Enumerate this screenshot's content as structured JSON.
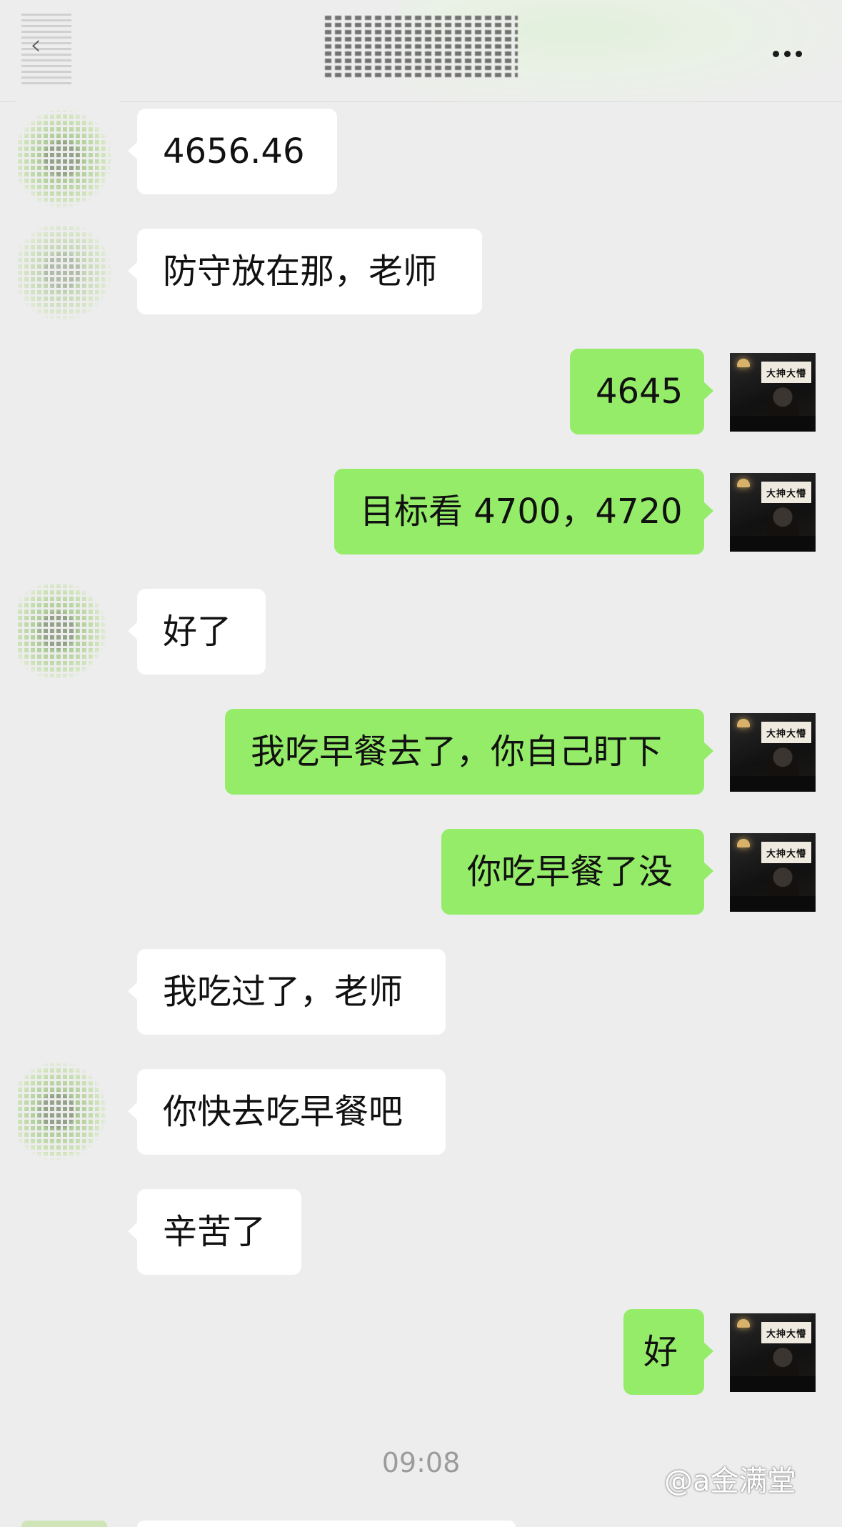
{
  "header": {
    "more_icon": "more-dots-icon",
    "back_icon": "chevron-left-icon"
  },
  "colors": {
    "background": "#ededed",
    "outgoing_bubble": "#95ec69",
    "incoming_bubble": "#ffffff",
    "timestamp_text": "#9b9b9b"
  },
  "avatar_sign_text": "大抻大懵",
  "messages": [
    {
      "direction": "in",
      "text": "4656.46"
    },
    {
      "direction": "in",
      "text": "防守放在那，老师"
    },
    {
      "direction": "out",
      "text": "4645"
    },
    {
      "direction": "out",
      "text": "目标看 4700，4720"
    },
    {
      "direction": "in",
      "text": "好了"
    },
    {
      "direction": "out",
      "text": "我吃早餐去了，你自己盯下"
    },
    {
      "direction": "out",
      "text": "你吃早餐了没"
    },
    {
      "direction": "in",
      "text": "我吃过了，老师"
    },
    {
      "direction": "in",
      "text": "你快去吃早餐吧"
    },
    {
      "direction": "in",
      "text": "辛苦了"
    },
    {
      "direction": "out",
      "text": "好"
    }
  ],
  "timestamp": "09:08",
  "watermark": "@a金满堂"
}
